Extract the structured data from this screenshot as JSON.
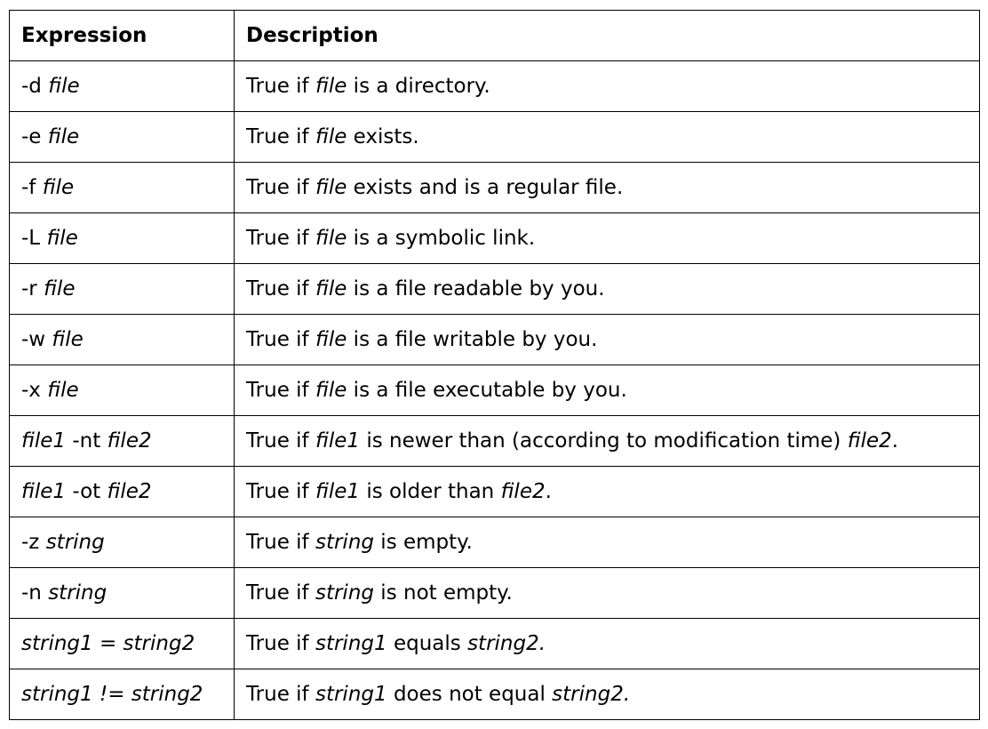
{
  "headers": {
    "expression": "Expression",
    "description": "Description"
  },
  "rows": [
    {
      "expr": [
        {
          "t": "-d "
        },
        {
          "t": "file",
          "i": true
        }
      ],
      "desc": [
        {
          "t": "True if "
        },
        {
          "t": "file",
          "i": true
        },
        {
          "t": " is a directory."
        }
      ]
    },
    {
      "expr": [
        {
          "t": "-e "
        },
        {
          "t": "file",
          "i": true
        }
      ],
      "desc": [
        {
          "t": "True if "
        },
        {
          "t": "file",
          "i": true
        },
        {
          "t": " exists."
        }
      ]
    },
    {
      "expr": [
        {
          "t": "-f "
        },
        {
          "t": "file",
          "i": true
        }
      ],
      "desc": [
        {
          "t": "True if "
        },
        {
          "t": "file",
          "i": true
        },
        {
          "t": " exists and is a regular file."
        }
      ]
    },
    {
      "expr": [
        {
          "t": "-L "
        },
        {
          "t": "file",
          "i": true
        }
      ],
      "desc": [
        {
          "t": "True if "
        },
        {
          "t": "file",
          "i": true
        },
        {
          "t": " is a symbolic link."
        }
      ]
    },
    {
      "expr": [
        {
          "t": "-r "
        },
        {
          "t": "file",
          "i": true
        }
      ],
      "desc": [
        {
          "t": "True if "
        },
        {
          "t": "file",
          "i": true
        },
        {
          "t": " is a file readable by you."
        }
      ]
    },
    {
      "expr": [
        {
          "t": "-w "
        },
        {
          "t": "file",
          "i": true
        }
      ],
      "desc": [
        {
          "t": "True if "
        },
        {
          "t": "file",
          "i": true
        },
        {
          "t": " is a file writable by you."
        }
      ]
    },
    {
      "expr": [
        {
          "t": "-x "
        },
        {
          "t": "file",
          "i": true
        }
      ],
      "desc": [
        {
          "t": "True if "
        },
        {
          "t": "file",
          "i": true
        },
        {
          "t": " is a file executable by you."
        }
      ]
    },
    {
      "expr": [
        {
          "t": "file1",
          "i": true
        },
        {
          "t": " -nt "
        },
        {
          "t": "file2",
          "i": true
        }
      ],
      "desc": [
        {
          "t": "True if "
        },
        {
          "t": "file1",
          "i": true
        },
        {
          "t": " is newer than (according to modification time) "
        },
        {
          "t": "file2",
          "i": true
        },
        {
          "t": "."
        }
      ]
    },
    {
      "expr": [
        {
          "t": "file1",
          "i": true
        },
        {
          "t": " -ot "
        },
        {
          "t": "file2",
          "i": true
        }
      ],
      "desc": [
        {
          "t": "True if "
        },
        {
          "t": "file1",
          "i": true
        },
        {
          "t": " is older than "
        },
        {
          "t": "file2",
          "i": true
        },
        {
          "t": "."
        }
      ]
    },
    {
      "expr": [
        {
          "t": "-z "
        },
        {
          "t": "string",
          "i": true
        }
      ],
      "desc": [
        {
          "t": "True if "
        },
        {
          "t": "string",
          "i": true
        },
        {
          "t": " is empty."
        }
      ]
    },
    {
      "expr": [
        {
          "t": "-n "
        },
        {
          "t": "string",
          "i": true
        }
      ],
      "desc": [
        {
          "t": "True if "
        },
        {
          "t": "string",
          "i": true
        },
        {
          "t": " is not empty."
        }
      ]
    },
    {
      "expr": [
        {
          "t": "string1 = string2",
          "i": true
        }
      ],
      "desc": [
        {
          "t": "True if "
        },
        {
          "t": "string1",
          "i": true
        },
        {
          "t": " equals "
        },
        {
          "t": "string2.",
          "i": true
        }
      ]
    },
    {
      "expr": [
        {
          "t": "string1 != string2",
          "i": true
        }
      ],
      "desc": [
        {
          "t": "True if "
        },
        {
          "t": "string1",
          "i": true
        },
        {
          "t": " does not equal "
        },
        {
          "t": "string2.",
          "i": true
        }
      ]
    }
  ]
}
